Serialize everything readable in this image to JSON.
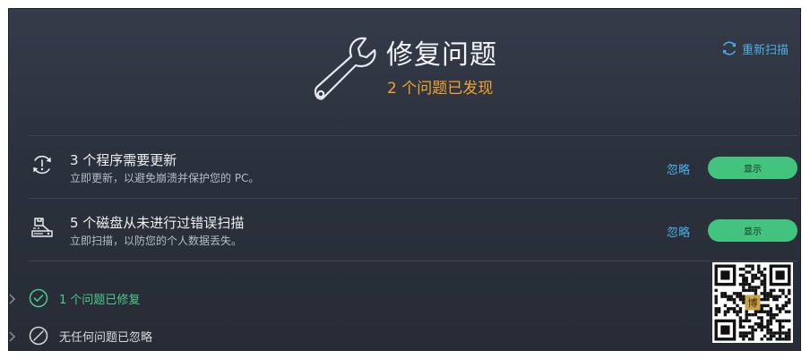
{
  "header": {
    "title": "修复问题",
    "subtitle": "2 个问题已发现",
    "rescan_label": "重新扫描",
    "subtitle_color": "#f2a331",
    "accent_color": "#4ab0e6"
  },
  "issues": [
    {
      "icon": "update-alert-icon",
      "title": "3 个程序需要更新",
      "description": "立即更新，以避免崩溃并保护您的 PC。",
      "ignore_label": "忽略",
      "show_label": "显示"
    },
    {
      "icon": "disk-scan-icon",
      "title": "5 个磁盘从未进行过错误扫描",
      "description": "立即扫描，以防您的个人数据丢失。",
      "ignore_label": "忽略",
      "show_label": "显示"
    }
  ],
  "status_rows": [
    {
      "icon": "check-circle-icon",
      "label": "1 个问题已修复",
      "color": "#4fc98b"
    },
    {
      "icon": "slash-circle-icon",
      "label": "无任何问题已忽略",
      "color": "#d6d9de"
    }
  ],
  "qr": {
    "icon": "qr-code-icon",
    "center_glyph": "博"
  },
  "colors": {
    "background": "#2b313c",
    "button_green": "#43c47e",
    "divider": "#3f4552"
  }
}
